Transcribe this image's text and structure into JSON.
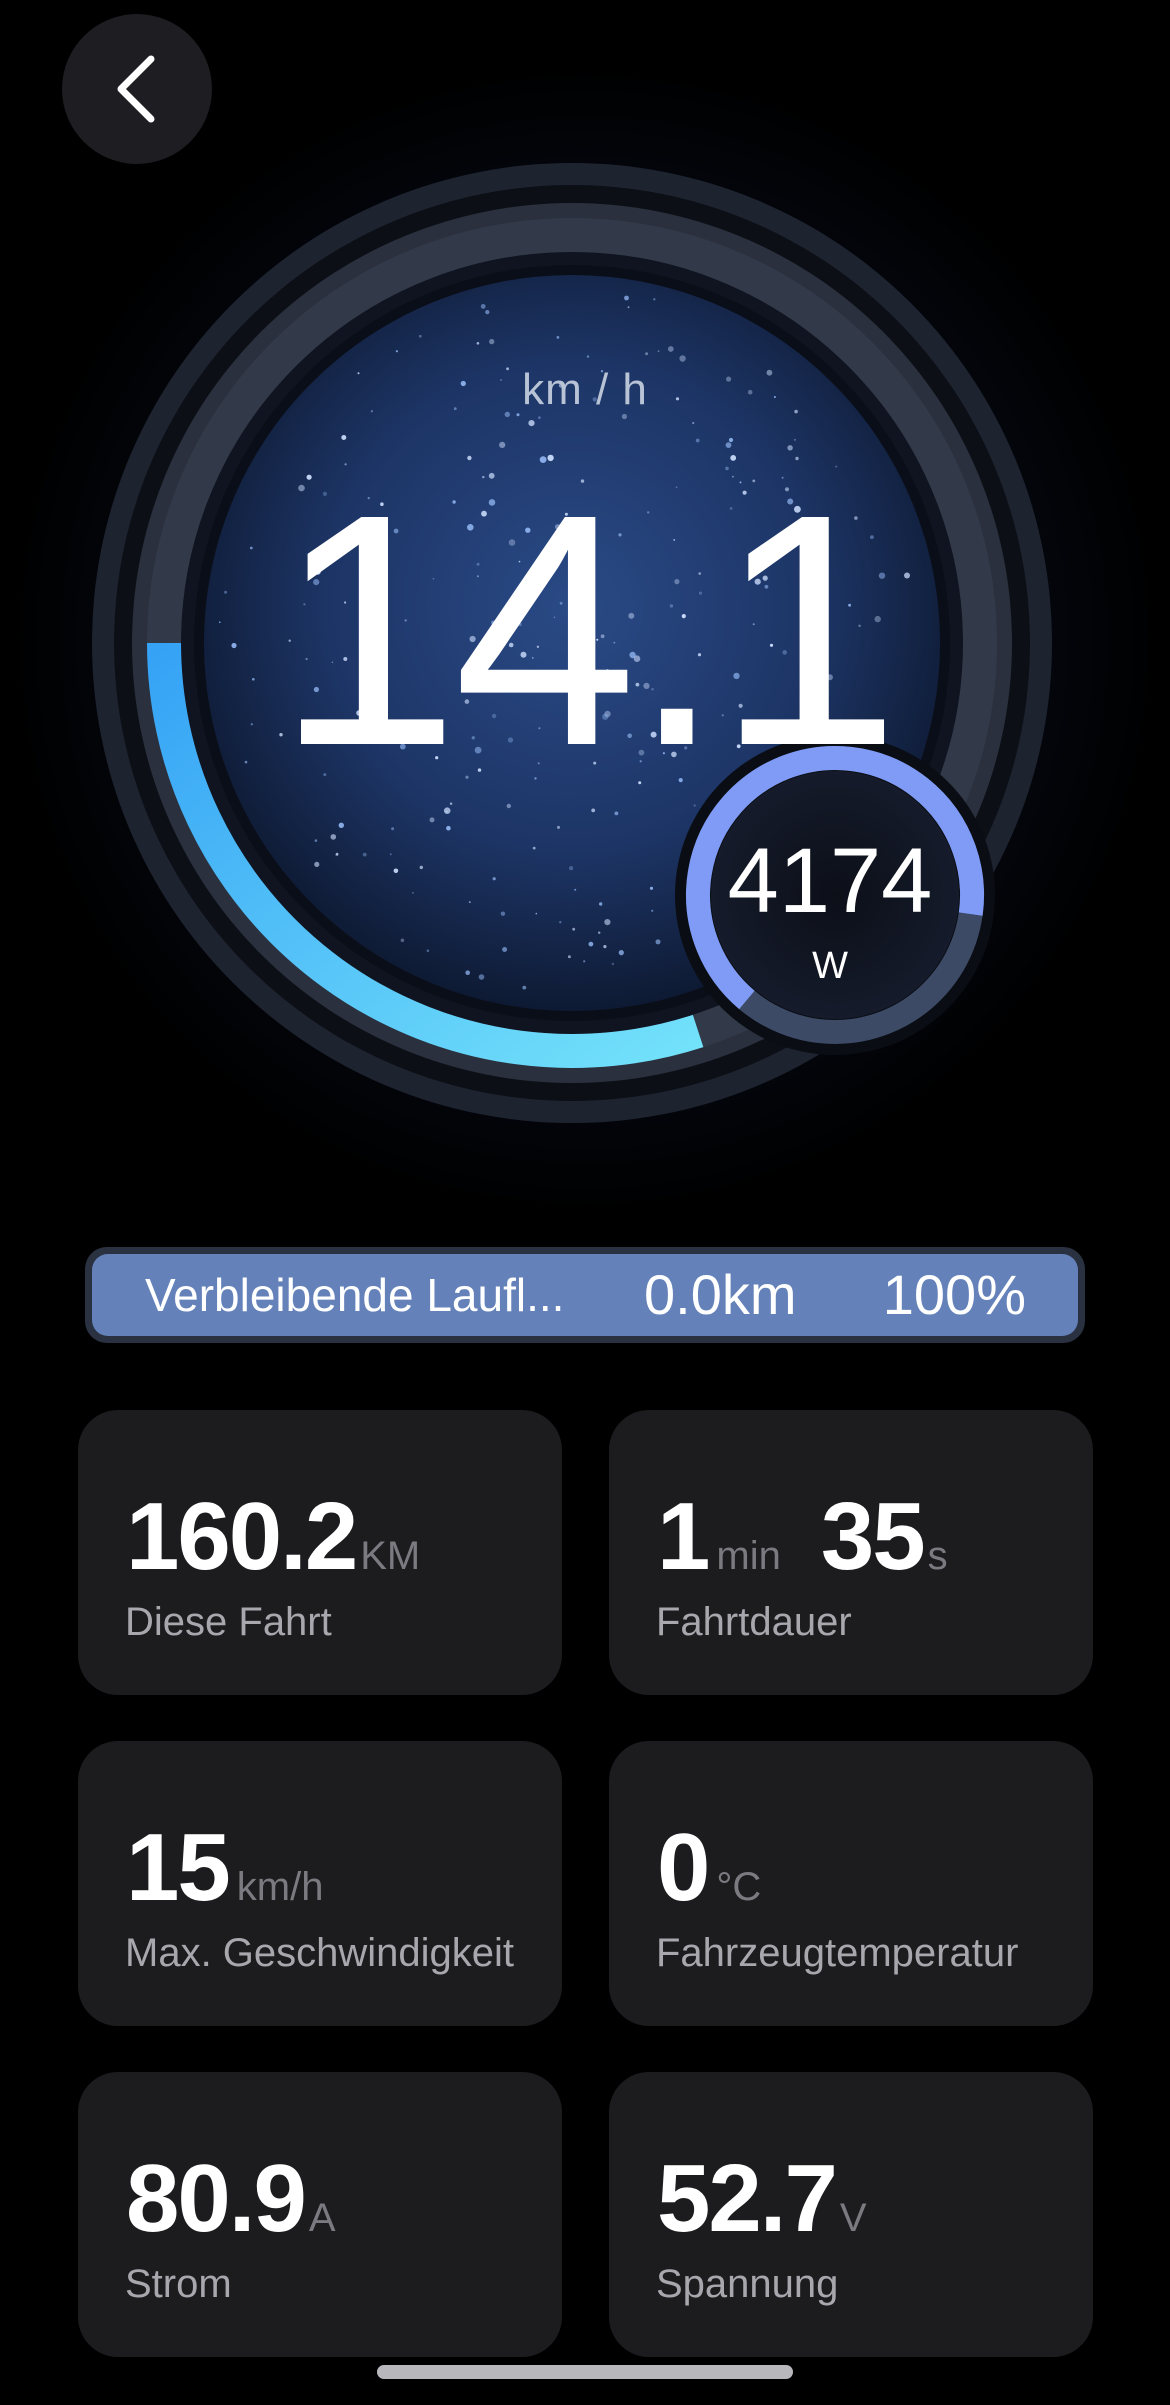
{
  "nav": {
    "back_icon": "chevron-left-icon"
  },
  "speedometer": {
    "speed": "14.1",
    "speed_unit": "km / h",
    "speed_arc_fraction": 0.4,
    "power": "4174",
    "power_unit": "W",
    "power_ring_fraction": 0.85,
    "colors": {
      "speed_arc_start": "#35a2f5",
      "speed_arc_end": "#73e2fa",
      "power_ring": "#7f9bf5"
    }
  },
  "range": {
    "label": "Verbleibende Laufl...",
    "distance": "0.0km",
    "battery": "100%"
  },
  "stats": [
    {
      "value": "160.2",
      "unit": "KM",
      "caption": "Diese Fahrt"
    },
    {
      "value_min": "1",
      "unit_min": "min",
      "value_sec": "35",
      "unit_sec": "s",
      "caption": "Fahrtdauer"
    },
    {
      "value": "15",
      "unit": "km/h",
      "caption": "Max. Geschwindigkeit"
    },
    {
      "value": "0",
      "unit": "°C",
      "caption": "Fahrzeugtemperatur"
    },
    {
      "value": "80.9",
      "unit": "A",
      "caption": "Strom"
    },
    {
      "value": "52.7",
      "unit": "V",
      "caption": "Spannung"
    }
  ]
}
